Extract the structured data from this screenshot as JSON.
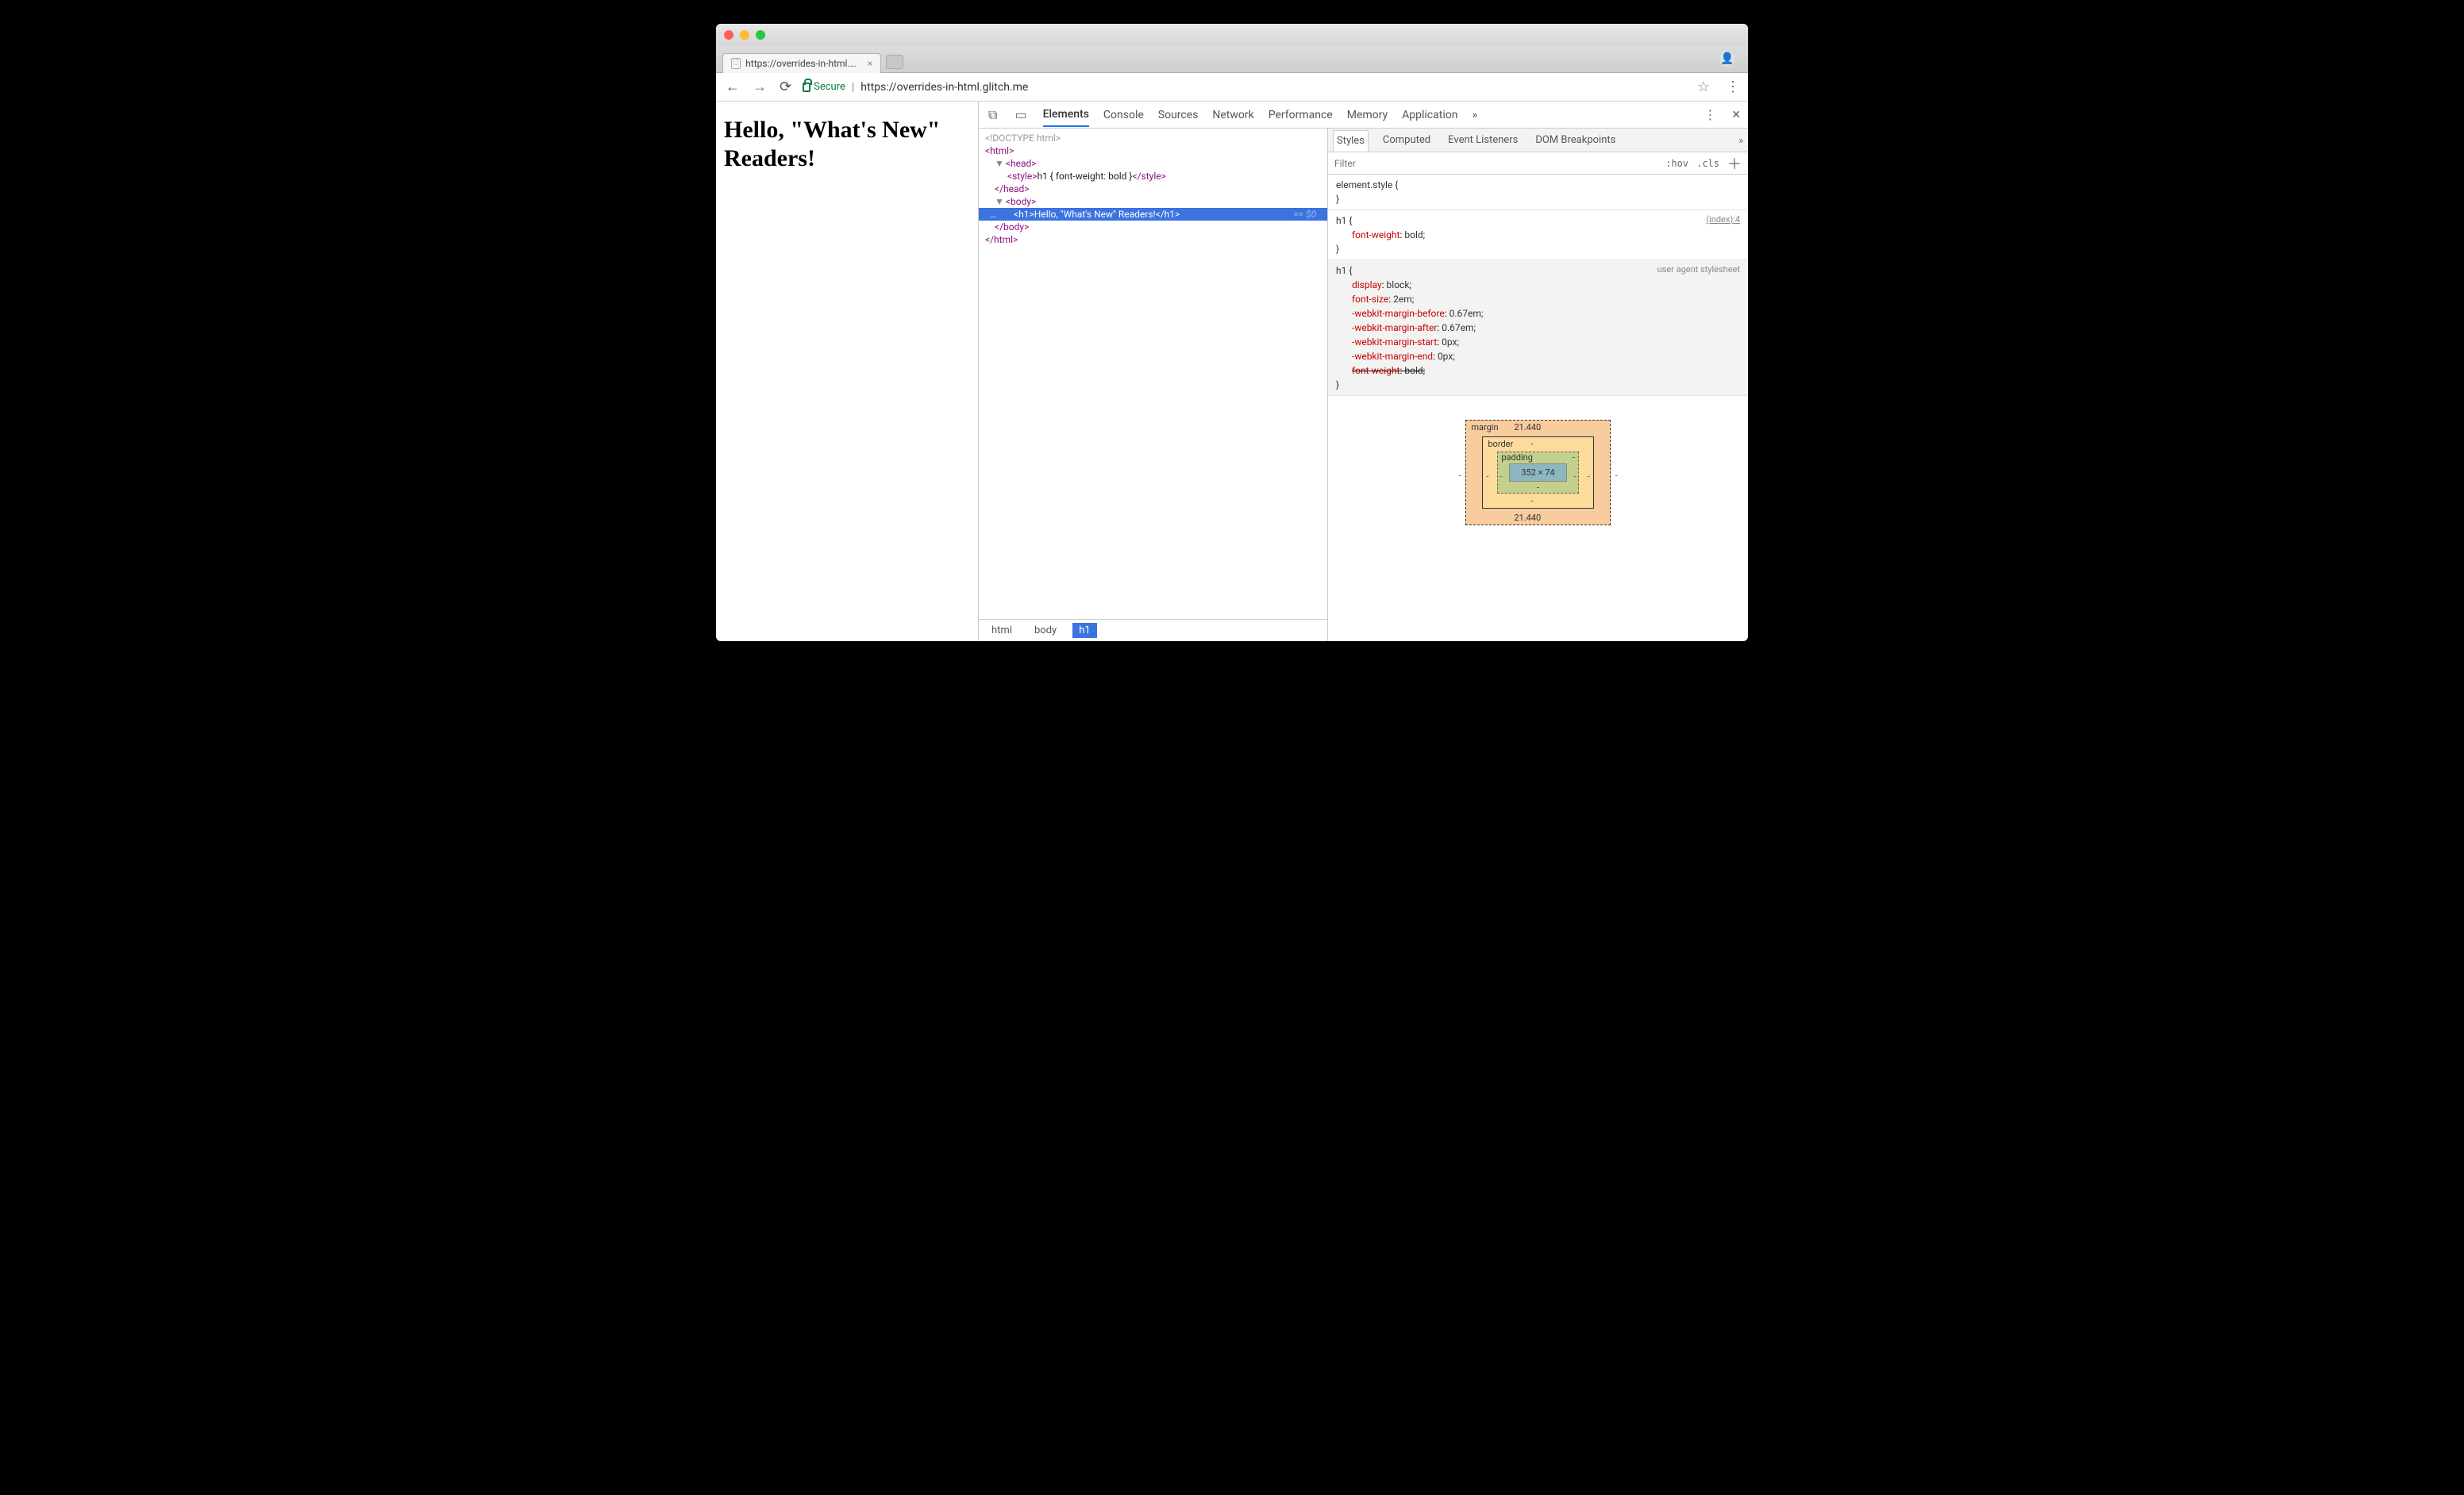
{
  "browser": {
    "tab_title": "https://overrides-in-html.glitch…",
    "url_display": "https://overrides-in-html.glitch.me",
    "secure_label": "Secure"
  },
  "page": {
    "heading": "Hello, \"What's New\" Readers!"
  },
  "devtools": {
    "tabs": [
      "Elements",
      "Console",
      "Sources",
      "Network",
      "Performance",
      "Memory",
      "Application"
    ],
    "active_tab": "Elements",
    "more_symbol": "»",
    "dom": {
      "doctype": "<!DOCTYPE html>",
      "html_open": "html",
      "head_open": "head",
      "style_tag_open": "style",
      "style_content": "h1 { font-weight: bold }",
      "style_tag_close": "/style",
      "head_close": "/head",
      "body_open": "body",
      "h1_open": "h1",
      "h1_text": "Hello, \"What's New\" Readers!",
      "h1_close": "/h1",
      "sel_indicator": "== $0",
      "body_close": "/body",
      "html_close": "/html",
      "gutter": "…"
    },
    "crumbs": [
      "html",
      "body",
      "h1"
    ],
    "styles_tabs": [
      "Styles",
      "Computed",
      "Event Listeners",
      "DOM Breakpoints"
    ],
    "filter_placeholder": "Filter",
    "hov": ":hov",
    "cls": ".cls",
    "rules": {
      "element_style": "element.style {",
      "h1_author": {
        "selector": "h1 {",
        "src": "(index):4",
        "props": [
          {
            "p": "font-weight",
            "v": "bold;"
          }
        ],
        "close": "}"
      },
      "h1_ua": {
        "selector": "h1 {",
        "src": "user agent stylesheet",
        "props": [
          {
            "p": "display",
            "v": "block;"
          },
          {
            "p": "font-size",
            "v": "2em;"
          },
          {
            "p": "-webkit-margin-before",
            "v": "0.67em;"
          },
          {
            "p": "-webkit-margin-after",
            "v": "0.67em;"
          },
          {
            "p": "-webkit-margin-start",
            "v": "0px;"
          },
          {
            "p": "-webkit-margin-end",
            "v": "0px;"
          },
          {
            "p": "font-weight",
            "v": "bold;",
            "strike": true
          }
        ],
        "close": "}"
      }
    },
    "box_model": {
      "margin_label": "margin",
      "margin_top": "21.440",
      "margin_right": "-",
      "margin_bottom": "21.440",
      "margin_left": "-",
      "border_label": "border",
      "border_val": "-",
      "padding_label": "padding",
      "padding_val": "-",
      "content": "352 × 74"
    }
  }
}
